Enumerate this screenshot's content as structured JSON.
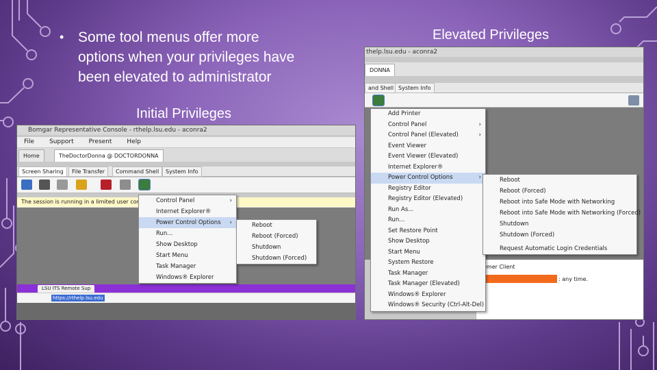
{
  "slide": {
    "bullet_marker": "•",
    "bullet_lines": [
      "Some tool menus offer more",
      "options when your privileges have",
      "been elevated to administrator"
    ],
    "label_initial": "Initial Privileges",
    "label_elevated": "Elevated Privileges",
    "colors": {
      "bg_light": "#a98ad0",
      "bg_dark": "#3e2160",
      "circuit": "#c9b4e4"
    }
  },
  "left": {
    "title": "Bomgar Representative Console - rthelp.lsu.edu - aconra2",
    "menu": [
      "File",
      "Support",
      "Present",
      "Help"
    ],
    "tabs": [
      "Home",
      "TheDoctorDonna @ DOCTORDONNA"
    ],
    "subtabs": [
      "Screen Sharing",
      "File Transfer",
      "Command Shell",
      "System Info"
    ],
    "notice": "The session is running in a limited user context",
    "main_menu": [
      "Control Panel",
      "Internet Explorer®",
      "Power Control Options",
      "Run...",
      "Show Desktop",
      "Start Menu",
      "Task Manager",
      "Windows® Explorer"
    ],
    "submenu": [
      "Reboot",
      "Reboot (Forced)",
      "Shutdown",
      "Shutdown (Forced)"
    ],
    "browser_tab": "LSU ITS Remote Sup",
    "url": "https://rthelp.lsu.edu"
  },
  "right": {
    "title": "thelp.lsu.edu - aconra2",
    "tab": "DONNA",
    "subtabs": [
      "and Shell",
      "System Info"
    ],
    "main_menu": [
      "Add Printer",
      "Control Panel",
      "Control Panel (Elevated)",
      "Event Viewer",
      "Event Viewer (Elevated)",
      "Internet Explorer®",
      "Power Control Options",
      "Registry Editor",
      "Registry Editor (Elevated)",
      "Run As...",
      "Run...",
      "Set Restore Point",
      "Show Desktop",
      "Start Menu",
      "System Restore",
      "Task Manager",
      "Task Manager (Elevated)",
      "Windows® Explorer",
      "Windows® Security (Ctrl-Alt-Del)"
    ],
    "submenu": [
      "Reboot",
      "Reboot (Forced)",
      "Reboot into Safe Mode with Networking",
      "Reboot into Safe Mode with Networking (Forced)",
      "Shutdown",
      "Shutdown (Forced)",
      "Request Automatic Login Credentials"
    ],
    "bg_window_title": "omer Client",
    "bg_window_text": ": any time."
  }
}
